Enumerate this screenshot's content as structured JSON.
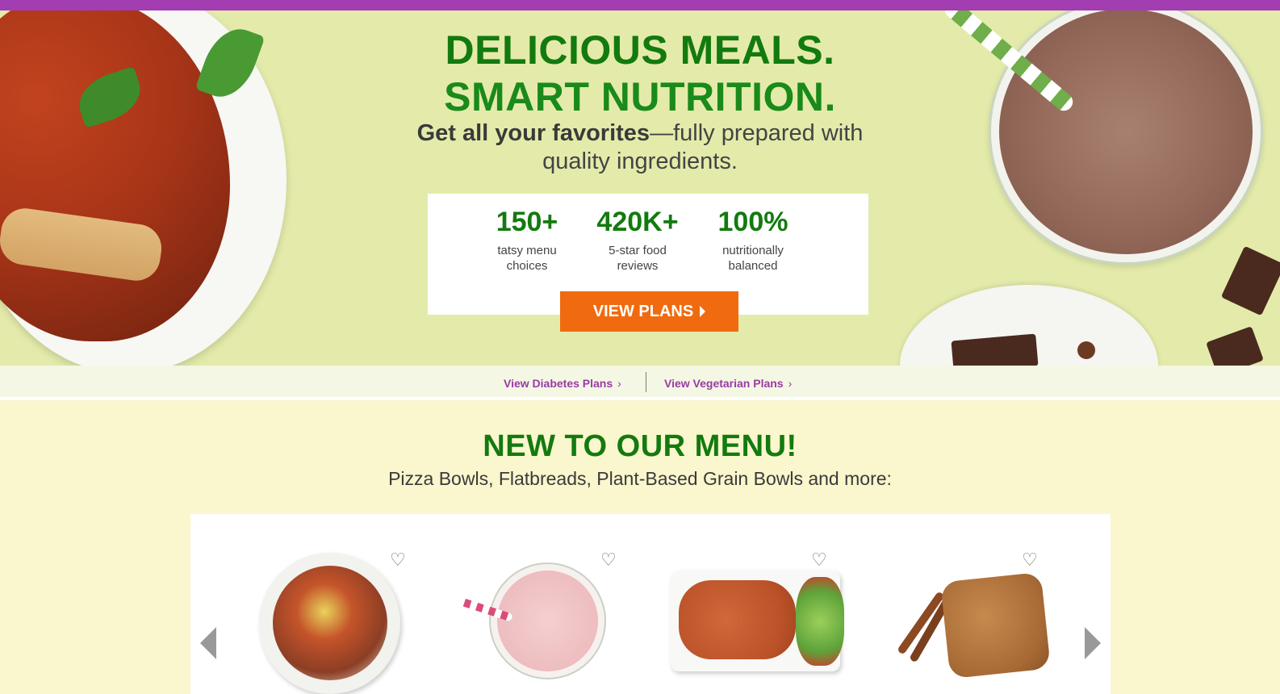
{
  "hero": {
    "title_line1": "DELICIOUS MEALS.",
    "title_line2": "SMART NUTRITION.",
    "subtitle_bold": "Get all your favorites",
    "subtitle_rest": "—fully prepared with quality ingredients.",
    "stats": [
      {
        "value": "150+",
        "label": "tatsy menu choices"
      },
      {
        "value": "420K+",
        "label": "5-star food reviews"
      },
      {
        "value": "100%",
        "label": "nutritionally balanced"
      }
    ],
    "cta_label": "VIEW PLANS"
  },
  "plan_links": [
    {
      "label": "View Diabetes Plans",
      "chevron": "›"
    },
    {
      "label": "View Vegetarian Plans",
      "chevron": "›"
    }
  ],
  "new_menu": {
    "title": "NEW TO OUR MENU!",
    "subtitle": "Pizza Bowls, Flatbreads, Plant-Based Grain Bowls and more:",
    "heart_glyph": "♡",
    "items": [
      {
        "icon": "pizza-bowl-image"
      },
      {
        "icon": "strawberry-shake-image"
      },
      {
        "icon": "flatbread-image"
      },
      {
        "icon": "cookie-image"
      }
    ]
  },
  "colors": {
    "promo_bar": "#a33db2",
    "hero_bg": "#e4ebaa",
    "brand_green": "#137a0f",
    "cta_orange": "#f06b0f",
    "link_purple": "#9a3aa8",
    "section_bg": "#faf6cd"
  }
}
